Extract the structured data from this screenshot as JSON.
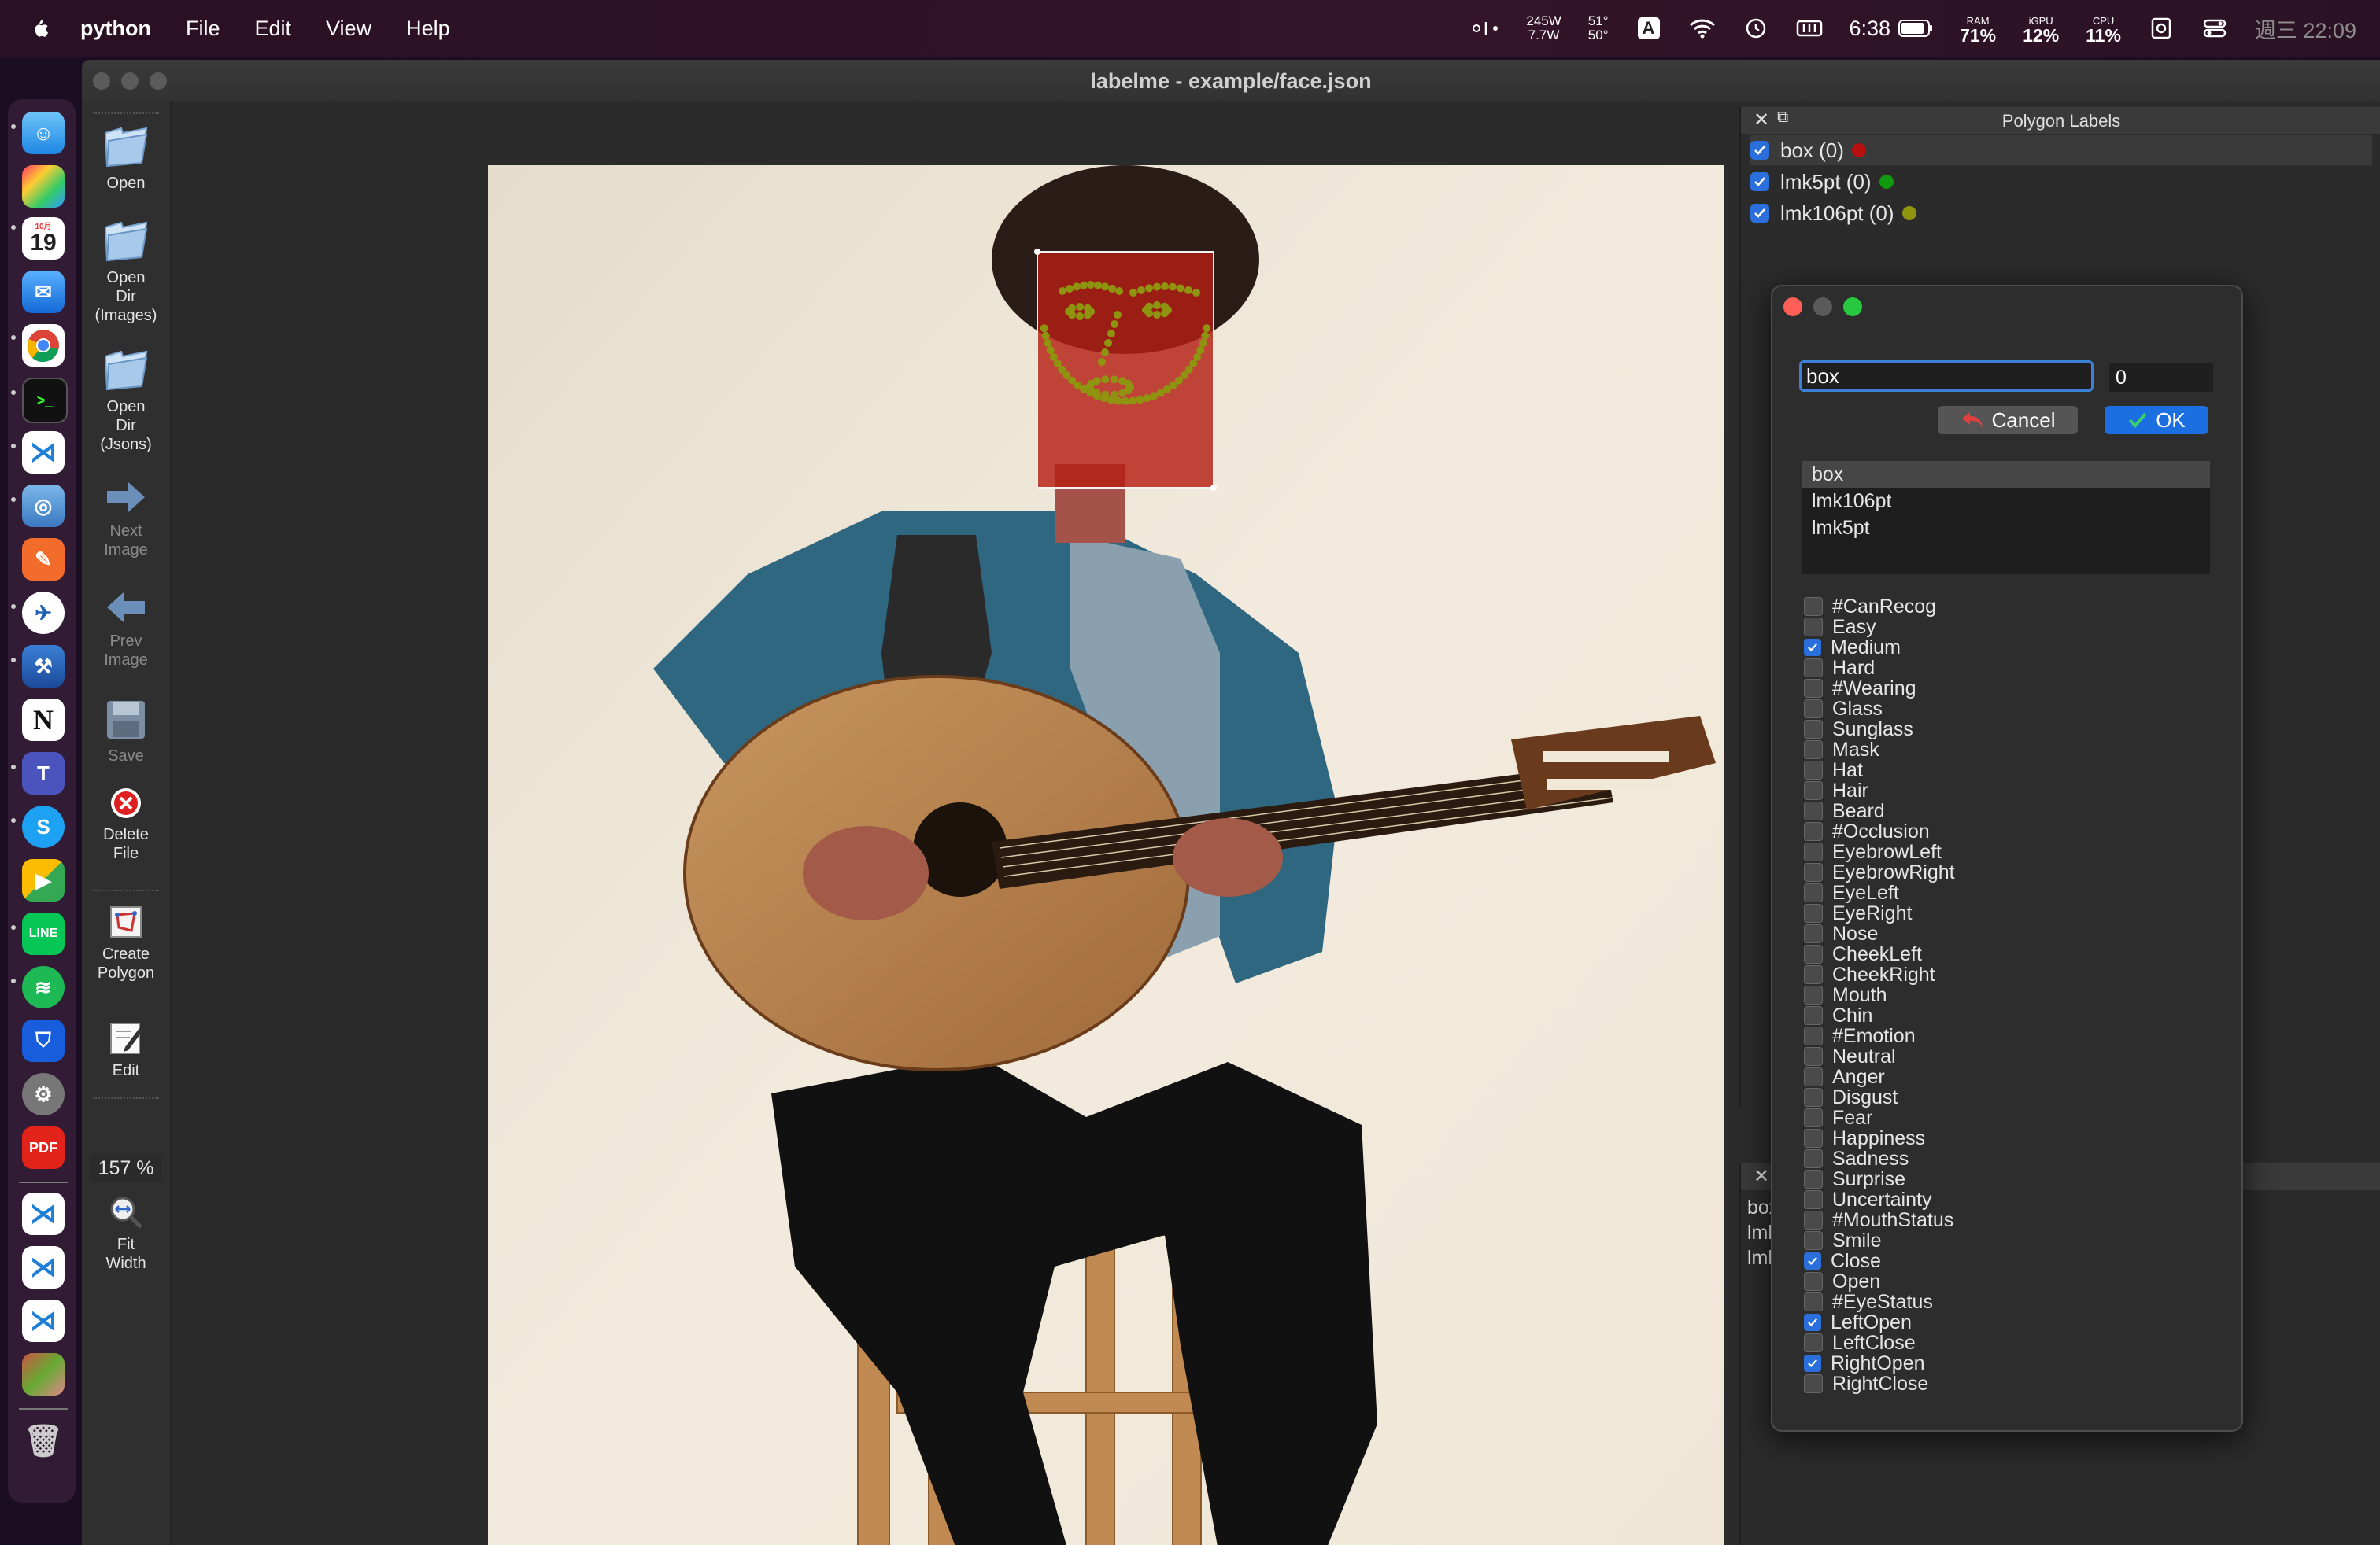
{
  "menubar": {
    "app": "python",
    "items": [
      "File",
      "Edit",
      "View",
      "Help"
    ],
    "power_top": "245W",
    "power_bottom": "7.7W",
    "temp_top": "51°",
    "temp_bottom": "50°",
    "input_source": "A",
    "battery_time": "6:38",
    "ram_label": "RAM",
    "ram_value": "71%",
    "gpu_label": "iGPU",
    "gpu_value": "12%",
    "cpu_label": "CPU",
    "cpu_value": "11%",
    "clock": "週三 22:09"
  },
  "dock": {
    "calendar_month": "10月",
    "calendar_day": "19"
  },
  "window": {
    "title": "labelme - example/face.json"
  },
  "toolbar": {
    "open": "Open",
    "open_dir_images": [
      "Open",
      "Dir",
      "(Images)"
    ],
    "open_dir_jsons": [
      "Open",
      "Dir",
      "(Jsons)"
    ],
    "next_image": [
      "Next",
      "Image"
    ],
    "prev_image": [
      "Prev",
      "Image"
    ],
    "save": "Save",
    "delete_file": [
      "Delete",
      "File"
    ],
    "create_polygon": [
      "Create",
      "Polygon"
    ],
    "edit": "Edit",
    "zoom": "157 %",
    "fit_width": [
      "Fit",
      "Width"
    ]
  },
  "polygon_labels": {
    "title": "Polygon Labels",
    "items": [
      {
        "label": "box (0)",
        "color": "#b80f0f"
      },
      {
        "label": "lmk5pt (0)",
        "color": "#0f9a0f"
      },
      {
        "label": "lmk106pt (0)",
        "color": "#8f9410"
      }
    ]
  },
  "file_panel": {
    "items": [
      {
        "label": "box",
        "color": "#b80f0f"
      },
      {
        "label": "lmk5pt",
        "color": "#0f9a0f"
      },
      {
        "label": "lmk106",
        "color": "#8f9410"
      }
    ]
  },
  "dialog": {
    "label_value": "box",
    "group_value": "0",
    "cancel": "Cancel",
    "ok": "OK",
    "label_list": [
      "box",
      "lmk106pt",
      "lmk5pt"
    ],
    "selected_label": "box",
    "flags": [
      {
        "name": "#CanRecog",
        "checked": false
      },
      {
        "name": "Easy",
        "checked": false
      },
      {
        "name": "Medium",
        "checked": true
      },
      {
        "name": "Hard",
        "checked": false
      },
      {
        "name": "#Wearing",
        "checked": false
      },
      {
        "name": "Glass",
        "checked": false
      },
      {
        "name": "Sunglass",
        "checked": false
      },
      {
        "name": "Mask",
        "checked": false
      },
      {
        "name": "Hat",
        "checked": false
      },
      {
        "name": "Hair",
        "checked": false
      },
      {
        "name": "Beard",
        "checked": false
      },
      {
        "name": "#Occlusion",
        "checked": false
      },
      {
        "name": "EyebrowLeft",
        "checked": false
      },
      {
        "name": "EyebrowRight",
        "checked": false
      },
      {
        "name": "EyeLeft",
        "checked": false
      },
      {
        "name": "EyeRight",
        "checked": false
      },
      {
        "name": "Nose",
        "checked": false
      },
      {
        "name": "CheekLeft",
        "checked": false
      },
      {
        "name": "CheekRight",
        "checked": false
      },
      {
        "name": "Mouth",
        "checked": false
      },
      {
        "name": "Chin",
        "checked": false
      },
      {
        "name": "#Emotion",
        "checked": false
      },
      {
        "name": "Neutral",
        "checked": false
      },
      {
        "name": "Anger",
        "checked": false
      },
      {
        "name": "Disgust",
        "checked": false
      },
      {
        "name": "Fear",
        "checked": false
      },
      {
        "name": "Happiness",
        "checked": false
      },
      {
        "name": "Sadness",
        "checked": false
      },
      {
        "name": "Surprise",
        "checked": false
      },
      {
        "name": "Uncertainty",
        "checked": false
      },
      {
        "name": "#MouthStatus",
        "checked": false
      },
      {
        "name": "Smile",
        "checked": false
      },
      {
        "name": "Close",
        "checked": true
      },
      {
        "name": "Open",
        "checked": false
      },
      {
        "name": "#EyeStatus",
        "checked": false
      },
      {
        "name": "LeftOpen",
        "checked": true
      },
      {
        "name": "LeftClose",
        "checked": false
      },
      {
        "name": "RightOpen",
        "checked": true
      },
      {
        "name": "RightClose",
        "checked": false
      }
    ]
  }
}
